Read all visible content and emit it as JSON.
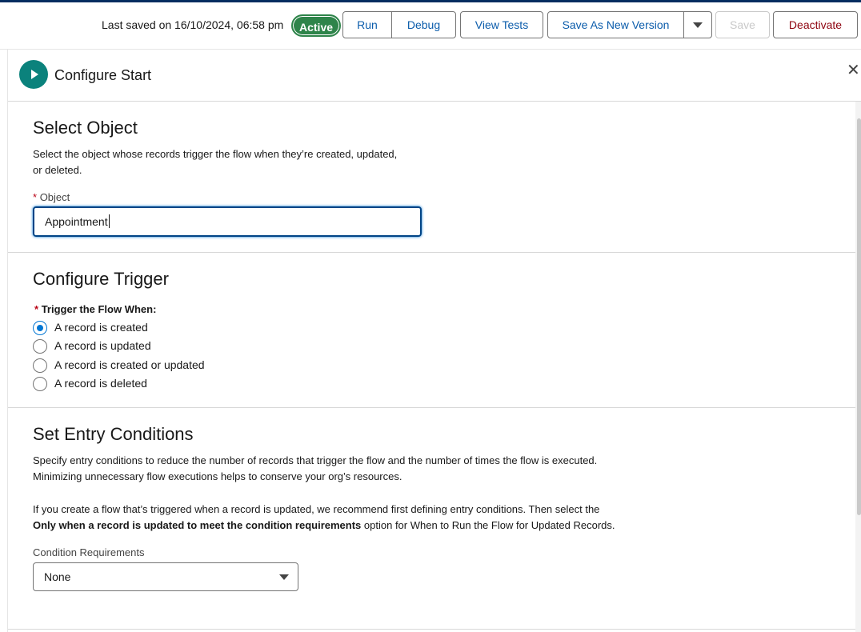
{
  "toolbar": {
    "last_saved": "Last saved on 16/10/2024, 06:58 pm",
    "status_badge": "Active",
    "run_label": "Run",
    "debug_label": "Debug",
    "view_tests_label": "View Tests",
    "save_new_version_label": "Save As New Version",
    "save_label": "Save",
    "deactivate_label": "Deactivate"
  },
  "panel": {
    "title": "Configure Start",
    "close_icon": "close-icon",
    "start_icon": "play-icon"
  },
  "select_object": {
    "title": "Select Object",
    "description_line1": "Select the object whose records trigger the flow when they’re created, updated,",
    "description_line2": "or deleted.",
    "required_mark": "*",
    "field_label": "Object",
    "field_value": "Appointment"
  },
  "configure_trigger": {
    "title": "Configure Trigger",
    "required_mark": "*",
    "field_label": "Trigger the Flow When:",
    "options": [
      {
        "label": "A record is created",
        "selected": true
      },
      {
        "label": "A record is updated",
        "selected": false
      },
      {
        "label": "A record is created or updated",
        "selected": false
      },
      {
        "label": "A record is deleted",
        "selected": false
      }
    ]
  },
  "entry_conditions": {
    "title": "Set Entry Conditions",
    "para1_line1": "Specify entry conditions to reduce the number of records that trigger the flow and the number of times the flow is executed.",
    "para1_line2": "Minimizing unnecessary flow executions helps to conserve your org’s resources.",
    "para2_line1": "If you create a flow that’s triggered when a record is updated, we recommend first defining entry conditions. Then select the",
    "para2_bold": "Only when a record is updated to meet the condition requirements",
    "para2_rest": " option for When to Run the Flow for Updated Records.",
    "condition_label": "Condition Requirements",
    "condition_value": "None"
  },
  "colors": {
    "brand_blue": "#0b5cab",
    "active_green": "#2e844a",
    "deactivate_red": "#8e030f",
    "start_teal": "#0b827c"
  }
}
